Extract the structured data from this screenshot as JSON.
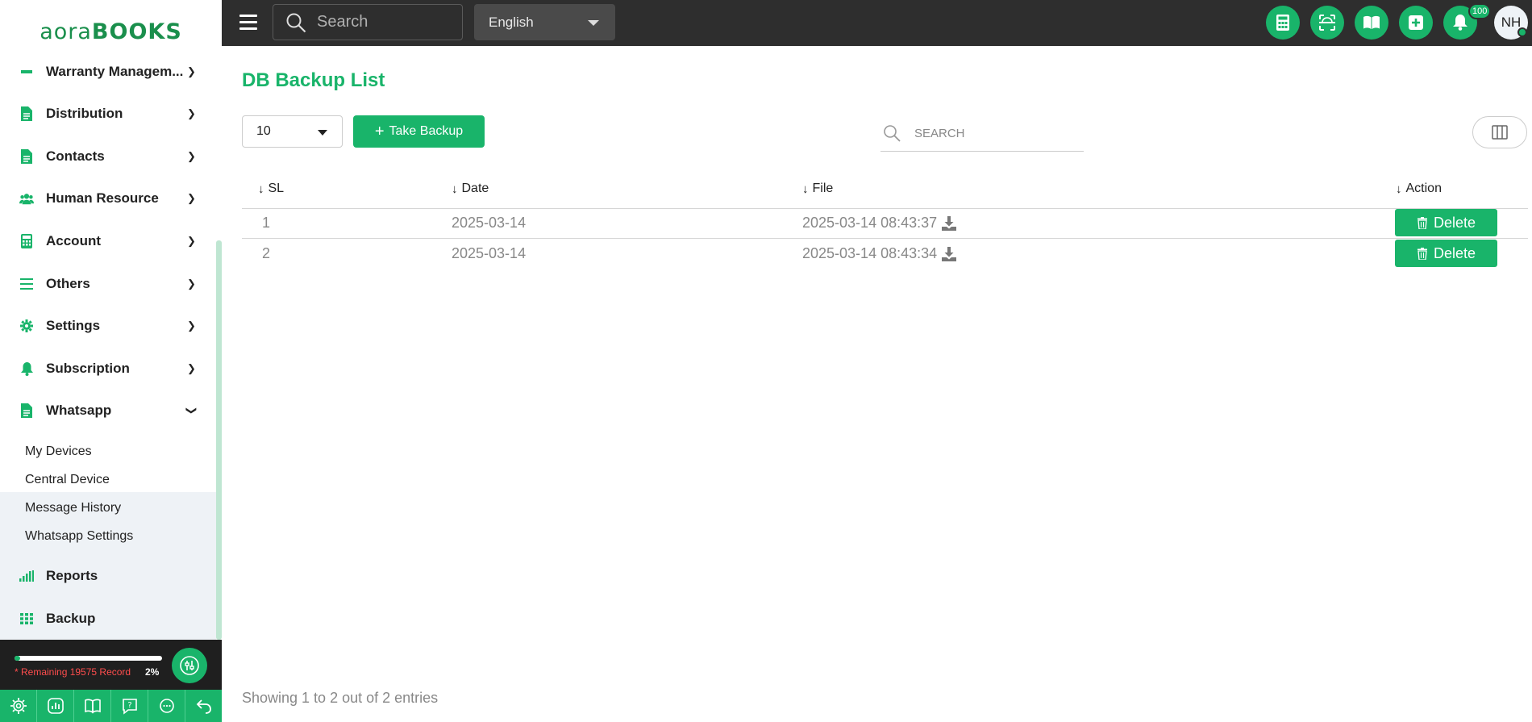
{
  "logo": {
    "part1": "aora",
    "part2": "BOOKS"
  },
  "topbar": {
    "search_placeholder": "Search",
    "language": "English",
    "notification_count": "100",
    "avatar_initials": "NH",
    "buttons": [
      "calculator-icon",
      "scan-icon",
      "book-icon",
      "add-icon",
      "bell-icon"
    ]
  },
  "sidebar": {
    "items": [
      {
        "label": "Warranty Managem...",
        "icon": "document-icon"
      },
      {
        "label": "Distribution",
        "icon": "document-icon"
      },
      {
        "label": "Contacts",
        "icon": "document-icon"
      },
      {
        "label": "Human Resource",
        "icon": "users-icon"
      },
      {
        "label": "Account",
        "icon": "calculator-icon"
      },
      {
        "label": "Others",
        "icon": "list-icon"
      },
      {
        "label": "Settings",
        "icon": "gear-icon"
      },
      {
        "label": "Subscription",
        "icon": "bell-icon"
      },
      {
        "label": "Whatsapp",
        "icon": "document-icon"
      },
      {
        "label": "Reports",
        "icon": "bar-chart-icon"
      },
      {
        "label": "Backup",
        "icon": "grid-icon"
      }
    ],
    "whatsapp_sub": [
      "My Devices",
      "Central Device",
      "Message History",
      "Whatsapp Settings"
    ]
  },
  "footer": {
    "remaining": "* Remaining 19575 Record",
    "percent": "2%",
    "progress": 0.02,
    "icons": [
      "gear-icon",
      "chart-icon",
      "book-icon",
      "help-icon",
      "chat-icon",
      "logout-icon"
    ]
  },
  "main": {
    "title": "DB Backup List",
    "per_page": "10",
    "take_backup": "Take Backup",
    "search_placeholder": "SEARCH",
    "columns": [
      "SL",
      "Date",
      "File",
      "Action"
    ],
    "rows": [
      {
        "sl": "1",
        "date": "2025-03-14",
        "file": "2025-03-14 08:43:37",
        "action": "Delete"
      },
      {
        "sl": "2",
        "date": "2025-03-14",
        "file": "2025-03-14 08:43:34",
        "action": "Delete"
      }
    ],
    "showing": "Showing 1 to 2 out of 2 entries"
  },
  "colors": {
    "accent": "#19b46a",
    "topbar": "#2e2e2e"
  }
}
